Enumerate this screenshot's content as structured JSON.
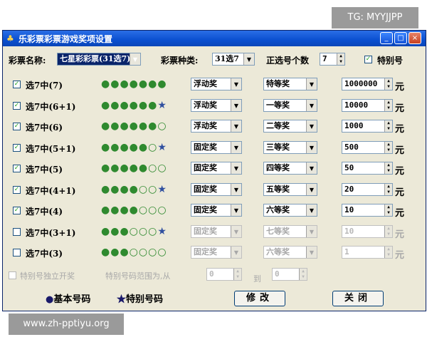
{
  "watermarks": {
    "top_right": "TG: MYYJJPP",
    "bottom_left": "www.zh-pptiyu.org"
  },
  "window": {
    "title": "乐彩票彩票游戏奖项设置",
    "buttons": {
      "minimize": "_",
      "maximize": "□",
      "close": "×"
    }
  },
  "top": {
    "name_label": "彩票名称:",
    "name_value": "七星彩彩票(31选7)",
    "type_label": "彩票种类:",
    "type_value": "31选7",
    "count_label": "正选号个数",
    "count_value": "7",
    "special_label": "特别号",
    "special_checked": true
  },
  "rows": [
    {
      "label": "选7中(7)",
      "checked": true,
      "enabled": true,
      "solid": 7,
      "hollow": 0,
      "star": false,
      "prize_type": "浮动奖",
      "level": "特等奖",
      "amount": "1000000"
    },
    {
      "label": "选7中(6+1)",
      "checked": true,
      "enabled": true,
      "solid": 6,
      "hollow": 0,
      "star": true,
      "prize_type": "浮动奖",
      "level": "一等奖",
      "amount": "10000"
    },
    {
      "label": "选7中(6)",
      "checked": true,
      "enabled": true,
      "solid": 6,
      "hollow": 1,
      "star": false,
      "prize_type": "浮动奖",
      "level": "二等奖",
      "amount": "1000"
    },
    {
      "label": "选7中(5+1)",
      "checked": true,
      "enabled": true,
      "solid": 5,
      "hollow": 1,
      "star": true,
      "prize_type": "固定奖",
      "level": "三等奖",
      "amount": "500"
    },
    {
      "label": "选7中(5)",
      "checked": true,
      "enabled": true,
      "solid": 5,
      "hollow": 2,
      "star": false,
      "prize_type": "固定奖",
      "level": "四等奖",
      "amount": "50"
    },
    {
      "label": "选7中(4+1)",
      "checked": true,
      "enabled": true,
      "solid": 4,
      "hollow": 2,
      "star": true,
      "prize_type": "固定奖",
      "level": "五等奖",
      "amount": "20"
    },
    {
      "label": "选7中(4)",
      "checked": true,
      "enabled": true,
      "solid": 4,
      "hollow": 3,
      "star": false,
      "prize_type": "固定奖",
      "level": "六等奖",
      "amount": "10"
    },
    {
      "label": "选7中(3+1)",
      "checked": false,
      "enabled": false,
      "solid": 3,
      "hollow": 3,
      "star": true,
      "prize_type": "固定奖",
      "level": "七等奖",
      "amount": "10"
    },
    {
      "label": "选7中(3)",
      "checked": false,
      "enabled": false,
      "solid": 3,
      "hollow": 4,
      "star": false,
      "prize_type": "固定奖",
      "level": "六等奖",
      "amount": "1"
    }
  ],
  "unit": "元",
  "bottom": {
    "separate_label": "特别号独立开奖",
    "range_label": "特别号码范围为,从",
    "from_value": "0",
    "to_label": "到",
    "to_value": "0"
  },
  "legend": {
    "basic": "基本号码",
    "special": "特别号码"
  },
  "actions": {
    "modify": "修改",
    "close": "关闭"
  },
  "symbols": {
    "solid": "●",
    "hollow": "○",
    "star": "★",
    "check": "✓"
  },
  "colors": {
    "ball": "#2f8a2f",
    "star": "#2f4f9f",
    "title_bar": "#0a4fd0"
  }
}
